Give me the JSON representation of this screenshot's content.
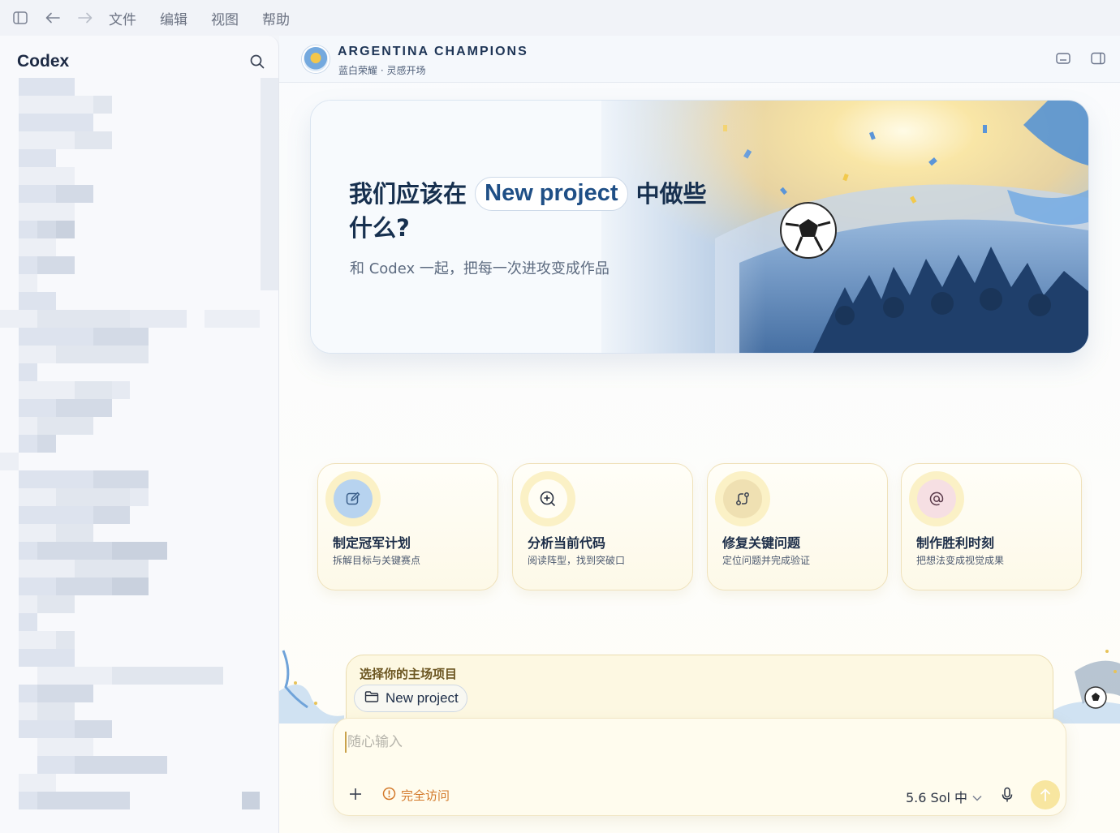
{
  "menubar": {
    "menus": [
      "文件",
      "编辑",
      "视图",
      "帮助"
    ]
  },
  "sidebar": {
    "title": "Codex"
  },
  "header": {
    "title": "ARGENTINA CHAMPIONS",
    "subtitle": "蓝白荣耀 · 灵感开场"
  },
  "hero": {
    "title_before": "我们应该在",
    "project_name": "New project",
    "title_after": "中做些什么?",
    "subtitle": "和 Codex 一起，把每一次进攻变成作品"
  },
  "cards": [
    {
      "title": "制定冠军计划",
      "subtitle": "拆解目标与关键赛点",
      "icon": "edit-icon",
      "color": "#b7d3ef"
    },
    {
      "title": "分析当前代码",
      "subtitle": "阅读阵型，找到突破口",
      "icon": "search-plus-icon",
      "color": "#fffdf4"
    },
    {
      "title": "修复关键问题",
      "subtitle": "定位问题并完成验证",
      "icon": "git-branch-icon",
      "color": "#efe0b2"
    },
    {
      "title": "制作胜利时刻",
      "subtitle": "把想法变成视觉成果",
      "icon": "at-sign-icon",
      "color": "#f6dfe3"
    }
  ],
  "chooser": {
    "label": "选择你的主场项目",
    "project": "New project"
  },
  "composer": {
    "placeholder": "随心输入",
    "access_label": "完全访问",
    "model_label": "5.6 Sol 中"
  },
  "colors": {
    "accent_navy": "#17304f",
    "card_border": "#efe1ba",
    "warning_orange": "#d3792a",
    "send_button": "#f8e6a0"
  }
}
